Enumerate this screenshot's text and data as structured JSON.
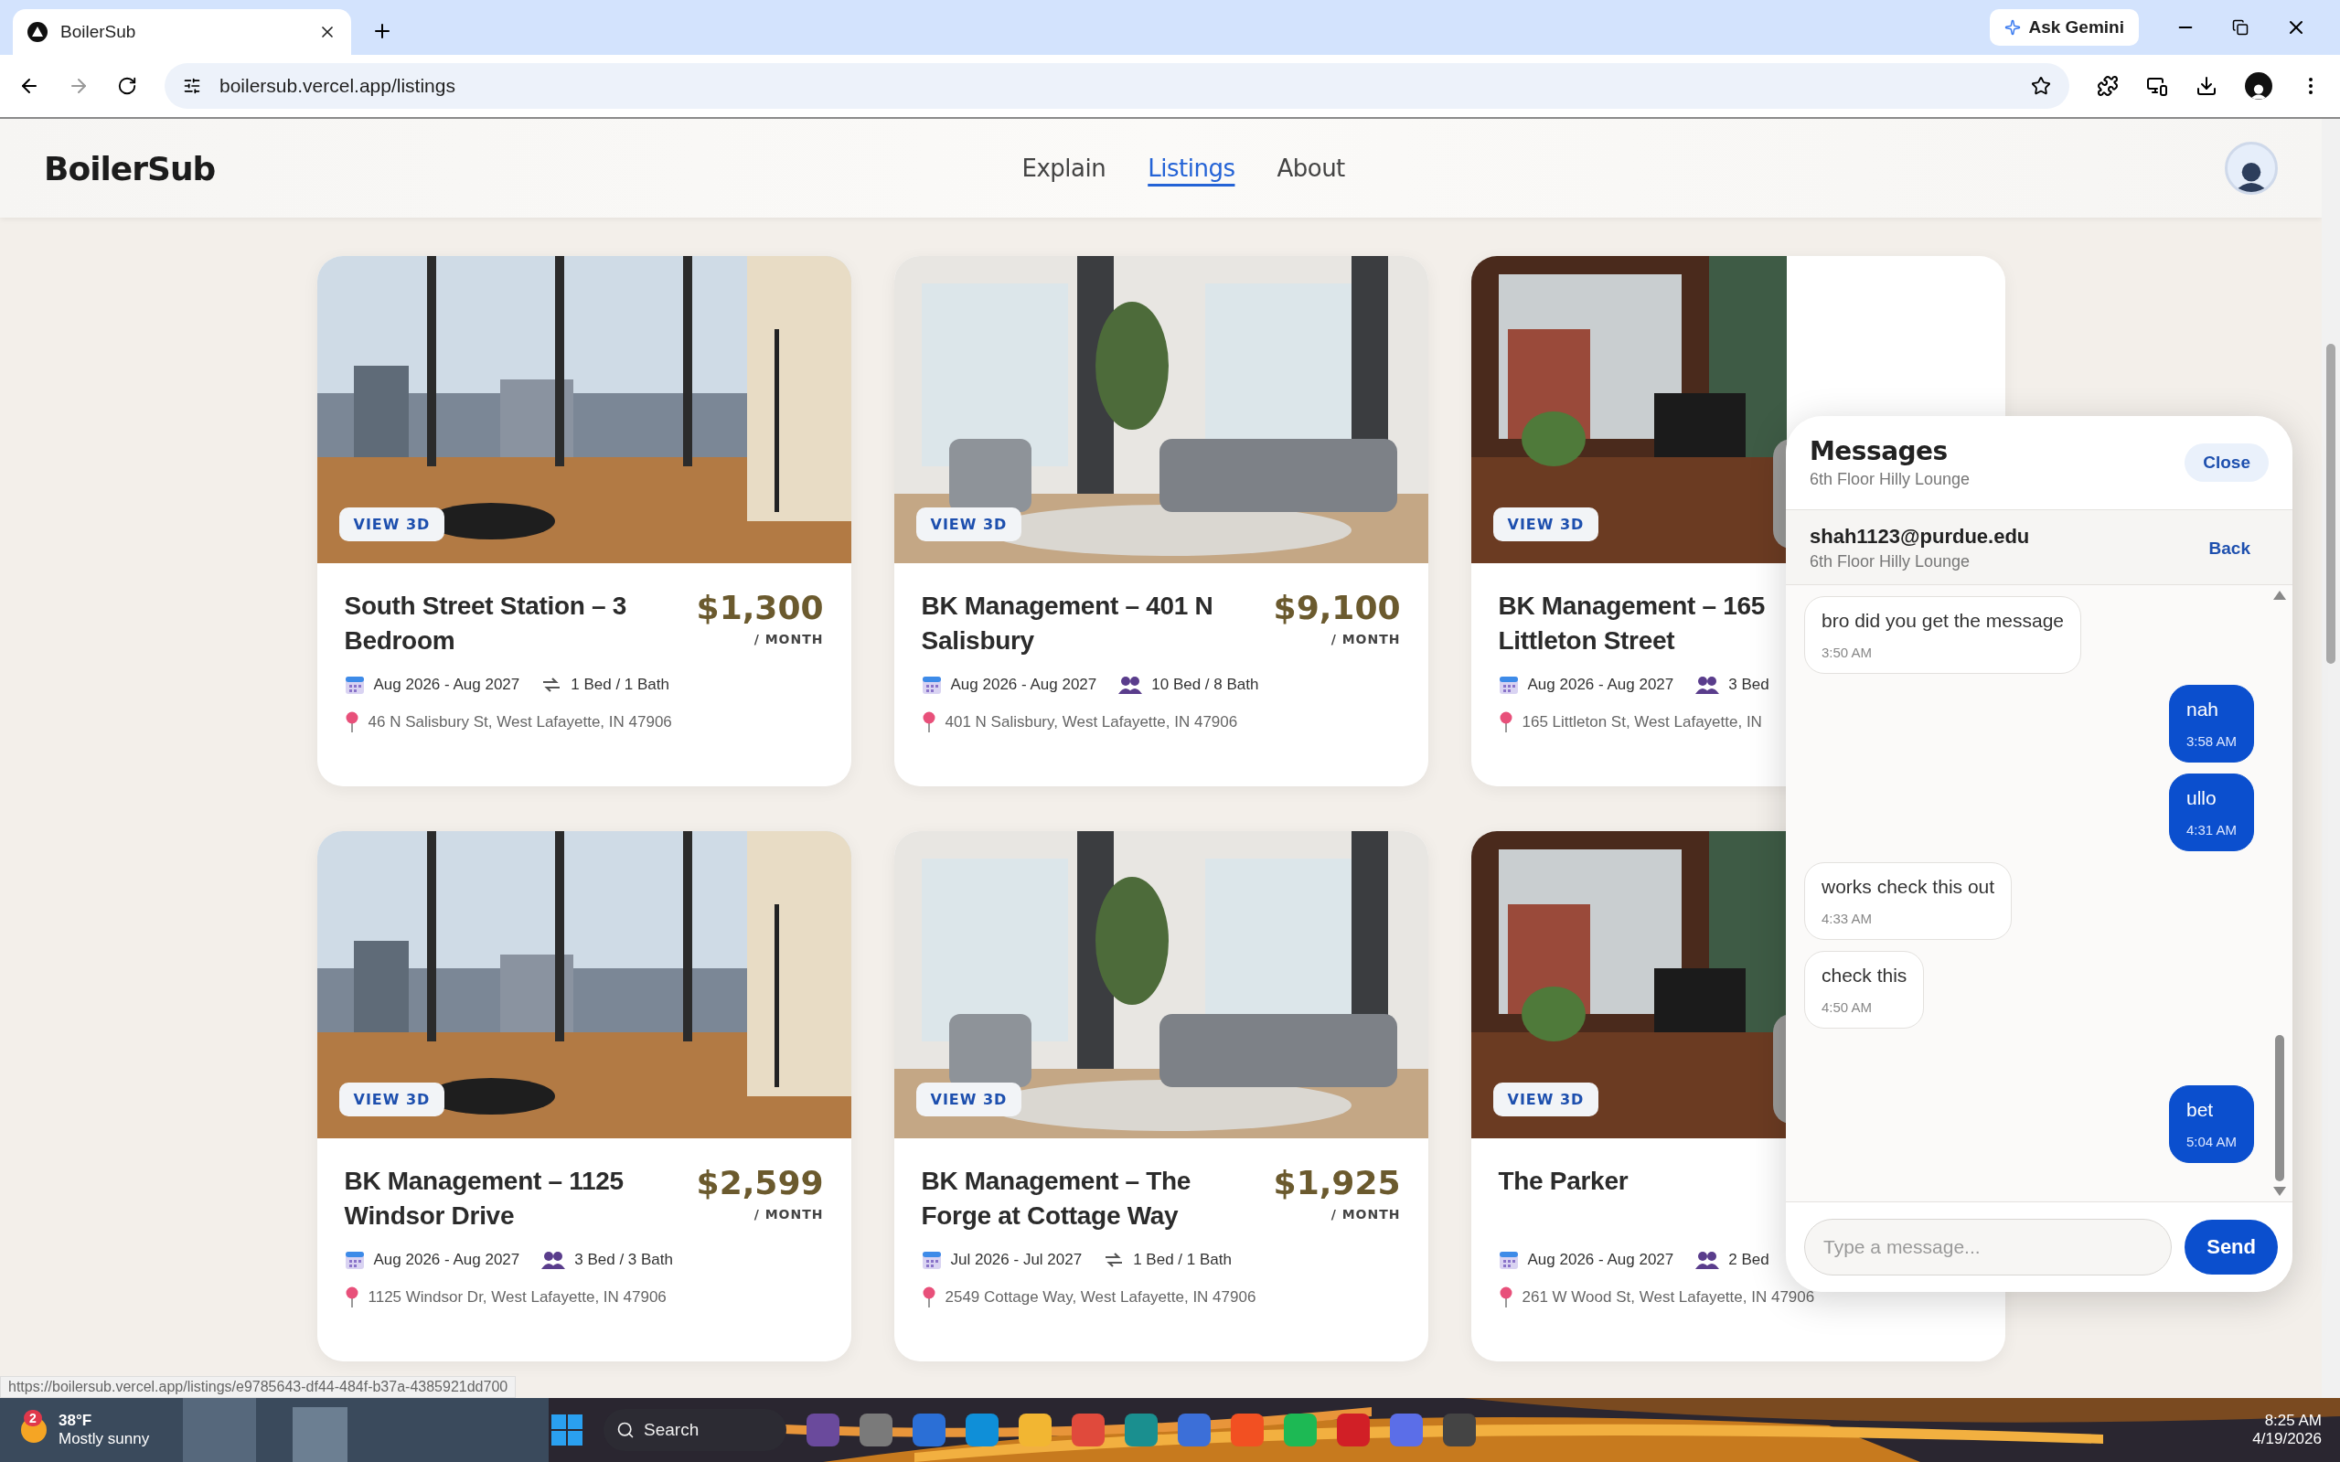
{
  "browser": {
    "tab_title": "BoilerSub",
    "ask_gemini": "Ask Gemini",
    "url": "boilersub.vercel.app/listings"
  },
  "site": {
    "logo": "BoilerSub",
    "nav": [
      {
        "label": "Explain",
        "selected": false
      },
      {
        "label": "Listings",
        "selected": true
      },
      {
        "label": "About",
        "selected": false
      }
    ]
  },
  "listings": [
    {
      "badge": "VIEW 3D",
      "title": "South Street Station – 3 Bedroom",
      "price": "$1,300",
      "period": "/ MONTH",
      "dates": "Aug 2026 - Aug 2027",
      "amenity": {
        "kind": "single",
        "text": "1 Bed / 1 Bath"
      },
      "address": "46 N Salisbury St, West Lafayette, IN 47906"
    },
    {
      "badge": "VIEW 3D",
      "title": "BK Management – 401 N Salisbury",
      "price": "$9,100",
      "period": "/ MONTH",
      "dates": "Aug 2026 - Aug 2027",
      "amenity": {
        "kind": "shared",
        "text": "10 Bed / 8 Bath"
      },
      "address": "401 N Salisbury, West Lafayette, IN 47906"
    },
    {
      "badge": "VIEW 3D",
      "title": "BK Management – 165 Littleton Street",
      "dates": "Aug 2026 - Aug 2027",
      "amenity": {
        "kind": "shared",
        "text": "3 Bed"
      },
      "address": "165 Littleton St, West Lafayette, IN"
    },
    {
      "badge": "VIEW 3D",
      "title": "BK Management – 1125 Windsor Drive",
      "price": "$2,599",
      "period": "/ MONTH",
      "dates": "Aug 2026 - Aug 2027",
      "amenity": {
        "kind": "shared",
        "text": "3 Bed / 3 Bath"
      },
      "address": "1125 Windsor Dr, West Lafayette, IN 47906"
    },
    {
      "badge": "VIEW 3D",
      "title": "BK Management – The Forge at Cottage Way",
      "price": "$1,925",
      "period": "/ MONTH",
      "dates": "Jul 2026 - Jul 2027",
      "amenity": {
        "kind": "single",
        "text": "1 Bed / 1 Bath"
      },
      "address": "2549 Cottage Way, West Lafayette, IN 47906"
    },
    {
      "badge": "VIEW 3D",
      "title": "The Parker",
      "dates": "Aug 2026 - Aug 2027",
      "amenity": {
        "kind": "shared",
        "text": "2 Bed"
      },
      "address": "261 W Wood St, West Lafayette, IN 47906"
    }
  ],
  "messages_panel": {
    "title": "Messages",
    "subtitle": "6th Floor Hilly Lounge",
    "close": "Close",
    "contact": {
      "email": "shah1123@purdue.edu",
      "subtitle": "6th Floor Hilly Lounge",
      "back": "Back"
    },
    "messages": [
      {
        "text": "bro did you get the message",
        "time": "3:50 AM",
        "outgoing": false
      },
      {
        "text": "nah",
        "time": "3:58 AM",
        "outgoing": true
      },
      {
        "text": "ullo",
        "time": "4:31 AM",
        "outgoing": true
      },
      {
        "text": "works check this out",
        "time": "4:33 AM",
        "outgoing": false
      },
      {
        "text": "check this",
        "time": "4:50 AM",
        "outgoing": false
      },
      {
        "text": "bet",
        "time": "5:04 AM",
        "outgoing": true
      }
    ],
    "input": {
      "placeholder": "Type a message..."
    },
    "send": "Send"
  },
  "status_url": "https://boilersub.vercel.app/listings/e9785643-df44-484f-b37a-4385921dd700",
  "taskbar": {
    "weather": {
      "badge": "2",
      "temp": "38°F",
      "condition": "Mostly sunny"
    },
    "search": "Search",
    "time": "8:25 AM",
    "date": "4/19/2026"
  }
}
